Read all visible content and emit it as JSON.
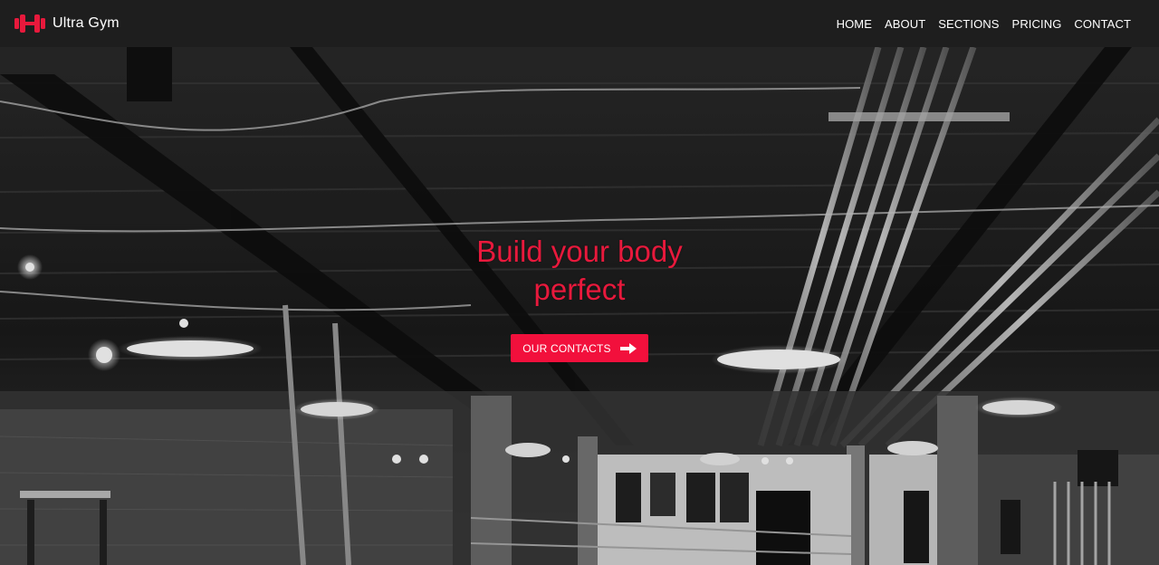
{
  "brand": {
    "name": "Ultra Gym",
    "icon": "dumbbell-icon",
    "color": "#e8193c"
  },
  "nav": {
    "items": [
      {
        "label": "HOME"
      },
      {
        "label": "ABOUT"
      },
      {
        "label": "SECTIONS"
      },
      {
        "label": "PRICING"
      },
      {
        "label": "CONTACT"
      }
    ]
  },
  "hero": {
    "title": "Build your body perfect",
    "button_label": "OUR CONTACTS",
    "button_icon": "arrow-right-icon",
    "accent_color": "#f2103c"
  }
}
